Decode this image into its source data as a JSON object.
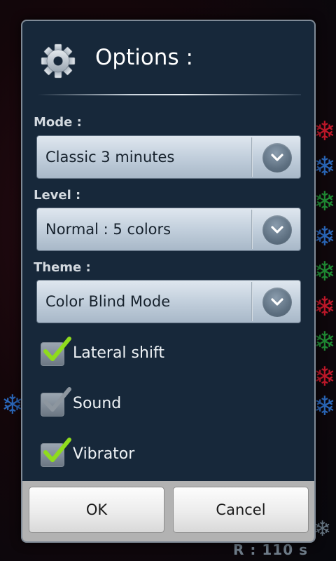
{
  "dialog": {
    "title": "Options :",
    "icon": "gear-icon"
  },
  "mode": {
    "label": "Mode :",
    "selected": "Classic 3 minutes"
  },
  "level": {
    "label": "Level :",
    "selected": "Normal : 5 colors"
  },
  "theme": {
    "label": "Theme :",
    "selected": "Color Blind Mode"
  },
  "options": [
    {
      "label": "Lateral shift",
      "checked": true
    },
    {
      "label": "Sound",
      "checked": false
    },
    {
      "label": "Vibrator",
      "checked": true
    }
  ],
  "buttons": {
    "ok": "OK",
    "cancel": "Cancel"
  },
  "background": {
    "timer": "R : 110 s"
  },
  "colors": {
    "dialog_bg": "#17283a",
    "check_green": "#8fdc1d",
    "check_gray": "#8d969f"
  }
}
